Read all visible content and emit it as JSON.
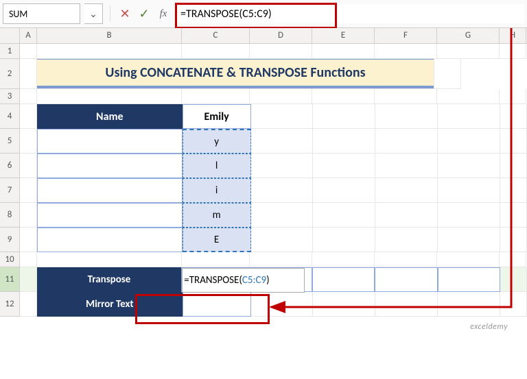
{
  "name_box": "SUM",
  "formula_bar": "=TRANSPOSE(C5:C9)",
  "formula_bar_ref": "C5:C9",
  "columns": [
    "A",
    "B",
    "C",
    "D",
    "E",
    "F",
    "G",
    "H"
  ],
  "rows": [
    "1",
    "2",
    "3",
    "4",
    "5",
    "6",
    "7",
    "8",
    "9",
    "10",
    "11",
    "12"
  ],
  "title": "Using CONCATENATE & TRANSPOSE Functions",
  "table": {
    "name_header": "Name",
    "value_header": "Emily",
    "cells": [
      "y",
      "l",
      "i",
      "m",
      "E"
    ]
  },
  "transpose_label": "Transpose",
  "mirror_label": "Mirror Text",
  "cell_formula_prefix": "=TRANSPOSE(",
  "cell_formula_ref": "C5:C9",
  "cell_formula_suffix": ")",
  "watermark": "exceldemy",
  "icons": {
    "chevron_down": "⌄",
    "cancel": "✕",
    "enter": "✓",
    "fx": "fx"
  },
  "colors": {
    "cancel": "#c0504d",
    "enter": "#548235",
    "ref": "#2f75b5"
  }
}
